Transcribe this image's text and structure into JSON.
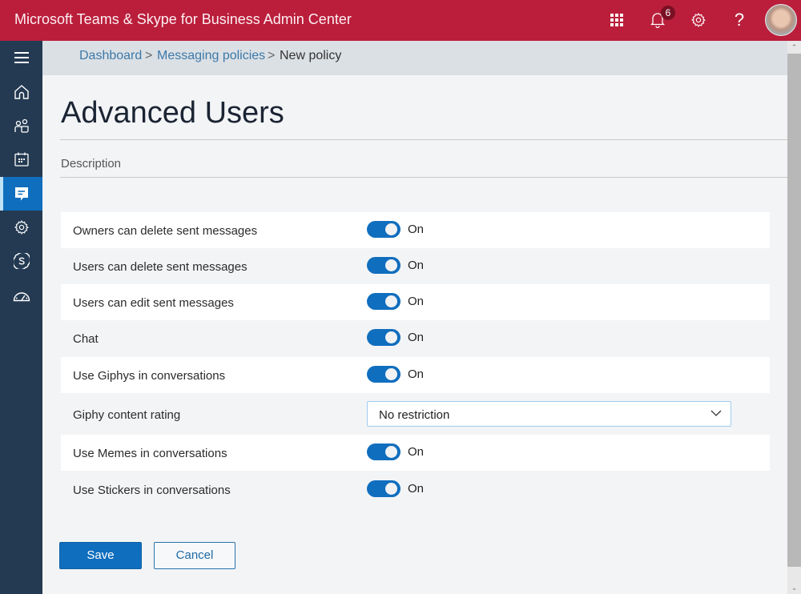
{
  "app": {
    "title": "Microsoft Teams & Skype for Business Admin Center",
    "notifications_count": "6",
    "header_icons": [
      "app-launcher-icon",
      "bell-icon",
      "gear-icon",
      "help-icon",
      "avatar"
    ],
    "brand_color": "#ba1e3b"
  },
  "sidebar": {
    "items": [
      {
        "name": "menu",
        "icon": "hamburger-icon"
      },
      {
        "name": "dashboard",
        "icon": "home-icon"
      },
      {
        "name": "users",
        "icon": "users-icon"
      },
      {
        "name": "meetings",
        "icon": "calendar-icon"
      },
      {
        "name": "messaging-policies",
        "icon": "chat-icon",
        "active": true
      },
      {
        "name": "org-settings",
        "icon": "gear-icon"
      },
      {
        "name": "skype",
        "icon": "skype-icon"
      },
      {
        "name": "call-quality",
        "icon": "speedometer-icon"
      }
    ]
  },
  "breadcrumb": {
    "items": [
      "Dashboard",
      "Messaging policies",
      "New policy"
    ],
    "separator": ">"
  },
  "page": {
    "title": "Advanced Users",
    "description_placeholder": "Description"
  },
  "settings": [
    {
      "label": "Owners can delete sent messages",
      "type": "toggle",
      "value": "On"
    },
    {
      "label": "Users can delete sent messages",
      "type": "toggle",
      "value": "On"
    },
    {
      "label": "Users can edit sent messages",
      "type": "toggle",
      "value": "On"
    },
    {
      "label": "Chat",
      "type": "toggle",
      "value": "On"
    },
    {
      "label": "Use Giphys in conversations",
      "type": "toggle",
      "value": "On"
    },
    {
      "label": "Giphy content rating",
      "type": "dropdown",
      "value": "No restriction"
    },
    {
      "label": "Use Memes in conversations",
      "type": "toggle",
      "value": "On"
    },
    {
      "label": "Use Stickers in conversations",
      "type": "toggle",
      "value": "On"
    }
  ],
  "actions": {
    "save_label": "Save",
    "cancel_label": "Cancel"
  },
  "colors": {
    "accent": "#106ebe",
    "sidebar": "#243a52"
  }
}
